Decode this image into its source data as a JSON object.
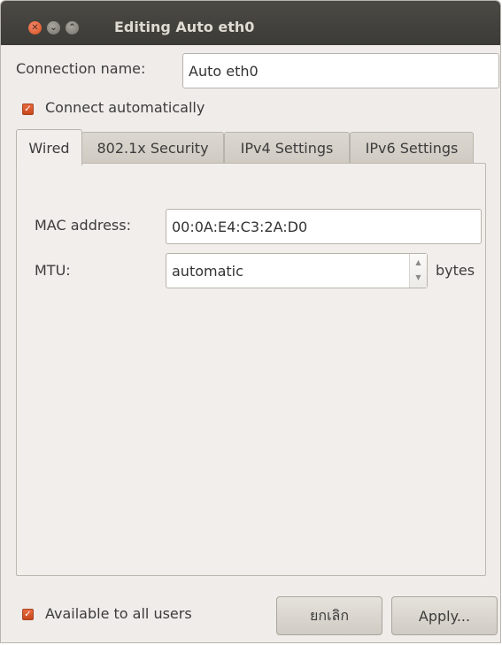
{
  "window": {
    "title": "Editing Auto eth0"
  },
  "connection_name": {
    "label": "Connection name:",
    "value": "Auto eth0"
  },
  "connect_automatically": {
    "label": "Connect automatically",
    "checked": true
  },
  "tabs": [
    {
      "label": "Wired",
      "active": true
    },
    {
      "label": "802.1x Security",
      "active": false
    },
    {
      "label": "IPv4 Settings",
      "active": false
    },
    {
      "label": "IPv6 Settings",
      "active": false
    }
  ],
  "wired": {
    "mac_label": "MAC address:",
    "mac_value": "00:0A:E4:C3:2A:D0",
    "mtu_label": "MTU:",
    "mtu_value": "automatic",
    "mtu_unit": "bytes"
  },
  "available_all_users": {
    "label": "Available to all users",
    "checked": true
  },
  "buttons": {
    "cancel": "ยกเลิก",
    "apply": "Apply..."
  },
  "colors": {
    "accent": "#dd5a26",
    "titlebar": "#3c3b37"
  }
}
